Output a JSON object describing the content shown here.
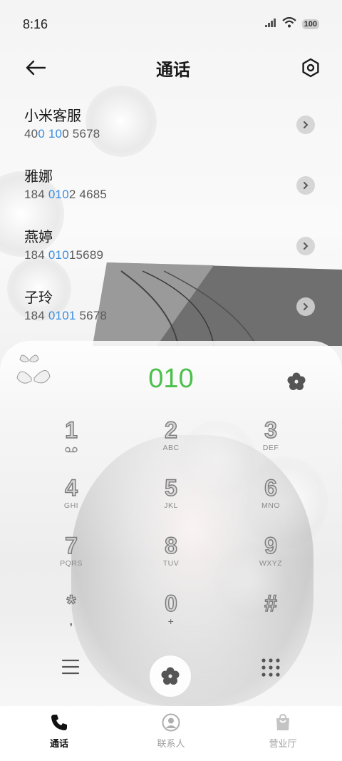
{
  "status_bar": {
    "time": "8:16",
    "battery": "100",
    "icons": [
      "signal-icon",
      "wifi-icon",
      "battery-icon"
    ]
  },
  "header": {
    "title": "通话",
    "back_icon": "arrow-left-icon",
    "settings_icon": "settings-icon"
  },
  "calls": [
    {
      "name": "小米客服",
      "number_parts": [
        "40",
        "0",
        " ",
        "10",
        "0 5678"
      ]
    },
    {
      "name": "雅娜",
      "number_parts": [
        "184 ",
        "010",
        "2 4685",
        "",
        ""
      ]
    },
    {
      "name": "燕婷",
      "number_parts": [
        "184 ",
        "010",
        "15689",
        "",
        ""
      ]
    },
    {
      "name": "子玲",
      "number_parts": [
        "184 ",
        "0101",
        " 5678",
        "",
        ""
      ]
    }
  ],
  "dialer": {
    "entered_number": "010",
    "accent": "#4cc04c",
    "highlight": "#3a8ee0",
    "keys": [
      {
        "digit": "1",
        "letters": "",
        "sub_icon": "voicemail-icon"
      },
      {
        "digit": "2",
        "letters": "ABC"
      },
      {
        "digit": "3",
        "letters": "DEF"
      },
      {
        "digit": "4",
        "letters": "GHI"
      },
      {
        "digit": "5",
        "letters": "JKL"
      },
      {
        "digit": "6",
        "letters": "MNO"
      },
      {
        "digit": "7",
        "letters": "PQRS"
      },
      {
        "digit": "8",
        "letters": "TUV"
      },
      {
        "digit": "9",
        "letters": "WXYZ"
      },
      {
        "digit": "*",
        "letters": ","
      },
      {
        "digit": "0",
        "letters": "+"
      },
      {
        "digit": "#",
        "letters": ""
      }
    ]
  },
  "nav": {
    "items": [
      {
        "label": "通话",
        "icon": "phone-icon",
        "active": true
      },
      {
        "label": "联系人",
        "icon": "contact-icon",
        "active": false
      },
      {
        "label": "营业厅",
        "icon": "shop-bag-icon",
        "active": false
      }
    ]
  }
}
